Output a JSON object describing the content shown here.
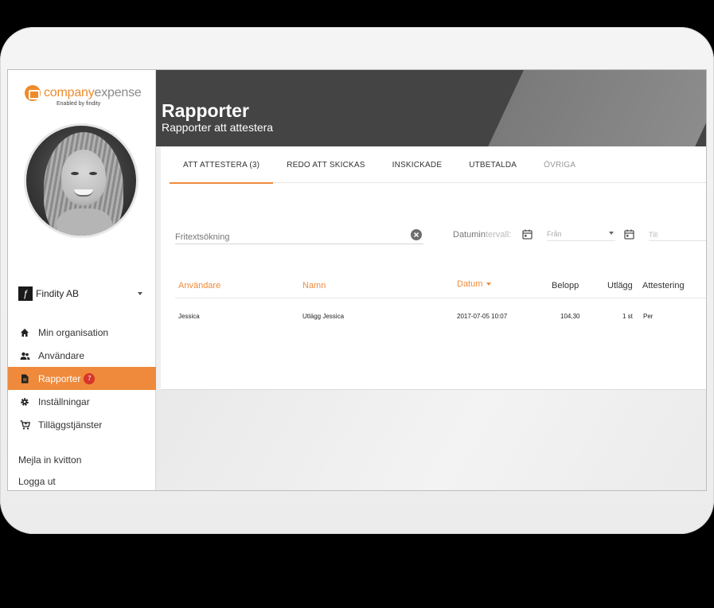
{
  "brand": {
    "logo_company": "company",
    "logo_expense": "expense",
    "logo_sub": "Enabled by findity"
  },
  "organization": {
    "name": "Findity AB"
  },
  "nav": {
    "items": [
      {
        "label": "Min organisation",
        "icon": "home-icon"
      },
      {
        "label": "Användare",
        "icon": "users-icon"
      },
      {
        "label": "Rapporter",
        "icon": "document-icon",
        "badge": "7",
        "active": true
      },
      {
        "label": "Inställningar",
        "icon": "gear-icon"
      },
      {
        "label": "Tilläggstjänster",
        "icon": "cart-icon"
      }
    ],
    "mail_receipts": "Mejla in kvitton",
    "logout": "Logga ut"
  },
  "header": {
    "title": "Rapporter",
    "subtitle": "Rapporter att attestera"
  },
  "tabs": [
    {
      "label": "ATT ATTESTERA (3)",
      "active": true
    },
    {
      "label": "REDO ATT SKICKAS"
    },
    {
      "label": "INSKICKADE"
    },
    {
      "label": "UTBETALDA"
    },
    {
      "label": "ÖVRIGA",
      "muted": true
    }
  ],
  "filters": {
    "search_placeholder": "Fritextsökning",
    "date_label_a": "Datumin",
    "date_label_b": "tervall:",
    "from_placeholder": "Från",
    "to_placeholder": "Till"
  },
  "table": {
    "columns": [
      "Användare",
      "Namn",
      "Datum",
      "Belopp",
      "Utlägg",
      "Attestering"
    ],
    "rows": [
      {
        "user": "Jessica",
        "name": "Utlägg Jessica",
        "date": "2017-07-05 10:07",
        "amount": "104,30",
        "expenses": "1 st",
        "approval": "Per"
      }
    ]
  },
  "colors": {
    "accent": "#ef8a3c",
    "header_bg": "#444444",
    "badge": "#d7342a"
  }
}
